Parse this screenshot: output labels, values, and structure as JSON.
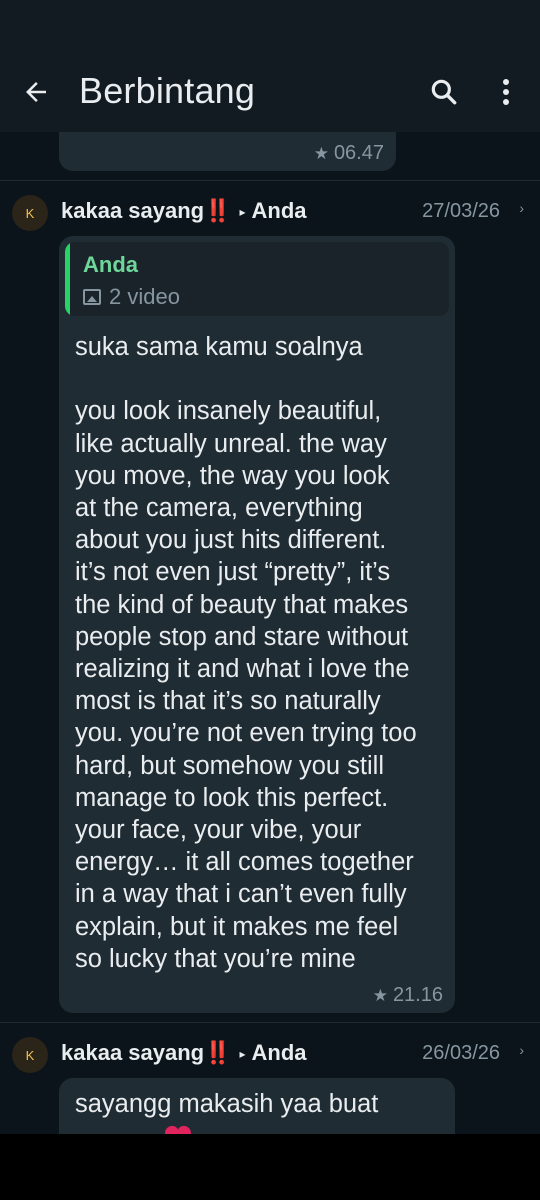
{
  "appbar": {
    "title": "Berbintang",
    "back_icon": "arrow-left-icon",
    "search_icon": "search-icon",
    "menu_icon": "more-vert-icon"
  },
  "messages": [
    {
      "partial": true,
      "time": "06.47",
      "starred": true
    },
    {
      "avatar_letter": "K",
      "sender": "kakaa sayang",
      "sender_emoji": "‼️",
      "recipient": "Anda",
      "date": "27/03/26",
      "quote": {
        "name": "Anda",
        "media_label": "2 video"
      },
      "text": "suka sama kamu soalnya\n\nyou look insanely beautiful,\nlike actually unreal. the way\nyou move, the way you look\nat the camera, everything\nabout you just hits different.\nit’s not even just “pretty”, it’s\nthe kind of beauty that makes\npeople stop and stare without\nrealizing it and what i love the\nmost is that it’s so naturally\nyou. you’re not even trying too\nhard, but somehow you still\nmanage to look this perfect.\nyour face, your vibe, your\nenergy… it all comes together\nin a way that i can’t even fully\nexplain, but it makes me feel\nso lucky that you’re mine",
      "time": "21.16",
      "starred": true
    },
    {
      "avatar_letter": "K",
      "sender": "kakaa sayang",
      "sender_emoji": "‼️",
      "recipient": "Anda",
      "date": "26/03/26",
      "text": "sayangg makasih yaa buat"
    }
  ],
  "colors": {
    "background": "#0b141a",
    "bubble": "#202c33",
    "appbar": "#121b22",
    "quote_accent": "#25d366",
    "avatar_text": "#f2c14e"
  }
}
